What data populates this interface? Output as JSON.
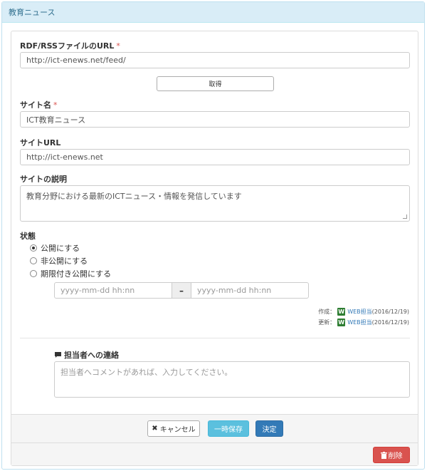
{
  "panel": {
    "title": "教育ニュース"
  },
  "rss": {
    "label": "RDF/RSSファイルのURL",
    "required": "*",
    "value": "http://ict-enews.net/feed/",
    "fetch_label": "取得"
  },
  "site_name": {
    "label": "サイト名",
    "required": "*",
    "value": "ICT教育ニュース"
  },
  "site_url": {
    "label": "サイトURL",
    "value": "http://ict-enews.net"
  },
  "site_desc": {
    "label": "サイトの説明",
    "value": "教育分野における最新のICTニュース・情報を発信しています"
  },
  "status": {
    "label": "状態",
    "options": [
      "公開にする",
      "非公開にする",
      "期限付き公開にする"
    ],
    "selected": 0,
    "date_start_placeholder": "yyyy-mm-dd hh:nn",
    "date_sep": "–",
    "date_end_placeholder": "yyyy-mm-dd hh:nn"
  },
  "meta": {
    "created_label": "作成：",
    "created_user": "WEB担当",
    "created_date": "(2016/12/19)",
    "updated_label": "更新：",
    "updated_user": "WEB担当",
    "updated_date": "(2016/12/19)",
    "badge": "W"
  },
  "contact": {
    "label": "担当者への連絡",
    "placeholder": "担当者へコメントがあれば、入力してください。"
  },
  "footer": {
    "cancel_label": "キャンセル",
    "temp_save_label": "一時保存",
    "decide_label": "決定",
    "delete_label": "削除"
  },
  "colors": {
    "header_bg": "#d9edf7",
    "temp_save": "#5bc0de",
    "decide": "#337ab7",
    "delete": "#d9534f"
  }
}
